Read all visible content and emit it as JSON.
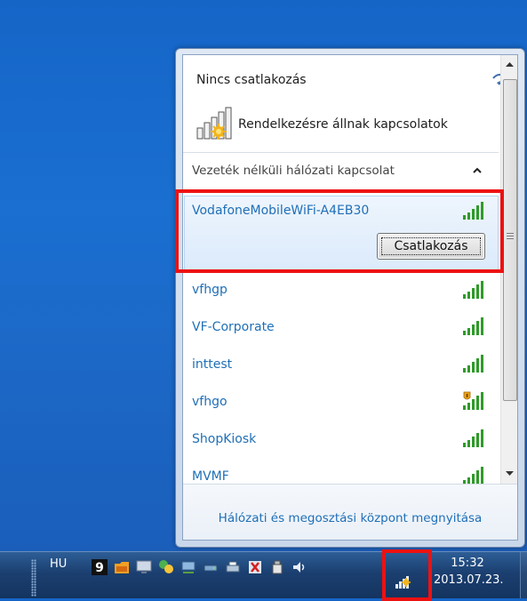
{
  "popup": {
    "status_title": "Nincs csatlakozás",
    "available_label": "Rendelkezésre állnak kapcsolatok",
    "section_label": "Vezeték nélküli hálózati kapcsolat",
    "networks": [
      {
        "name": "VodafoneMobileWiFi-A4EB30",
        "selected": true,
        "secured": false
      },
      {
        "name": "vfhgp",
        "secured": false
      },
      {
        "name": "VF-Corporate",
        "secured": false
      },
      {
        "name": "inttest",
        "secured": false
      },
      {
        "name": "vfhgo",
        "secured": true
      },
      {
        "name": "ShopKiosk",
        "secured": false
      },
      {
        "name": "MVMF",
        "secured": false
      }
    ],
    "connect_button": "Csatlakozás",
    "footer_link": "Hálózati és megosztási központ megnyitása"
  },
  "taskbar": {
    "language": "HU",
    "clock_time": "15:32",
    "clock_date": "2013.07.23.",
    "tray_icons": [
      "nine-icon",
      "folder-icon",
      "monitor-icon",
      "chat-icon",
      "network-share-icon",
      "drive-icon",
      "printer-icon",
      "flag-icon",
      "usb-icon",
      "volume-icon",
      "wifi-icon"
    ]
  },
  "colors": {
    "desktop": "#1a6fd0",
    "link": "#1f6fb7",
    "highlight": "#ee1111",
    "signal": "#2f9a2a"
  }
}
